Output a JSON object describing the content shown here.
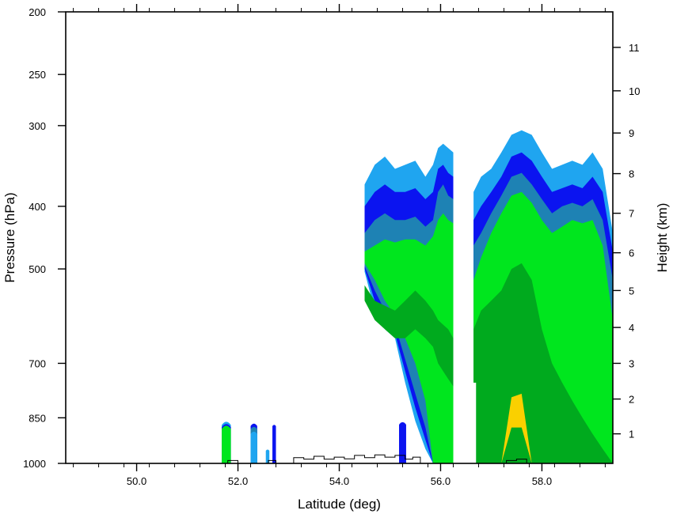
{
  "chart_data": {
    "type": "contour",
    "title": "",
    "xlabel": "Latitude (deg)",
    "ylabel": "Pressure (hPa)",
    "y2label": "Height (km)",
    "x_range": [
      48.6,
      59.4
    ],
    "x_ticks": [
      "50.0",
      "52.0",
      "54.0",
      "56.0",
      "58.0"
    ],
    "x_tick_values": [
      50,
      52,
      54,
      56,
      58
    ],
    "y_range_hpa": [
      1000,
      200
    ],
    "y_scale": "log",
    "y_ticks": [
      "200",
      "250",
      "300",
      "400",
      "500",
      "700",
      "850",
      "1000"
    ],
    "y_tick_values": [
      200,
      250,
      300,
      400,
      500,
      700,
      850,
      1000
    ],
    "y2_ticks": [
      "1",
      "2",
      "3",
      "4",
      "5",
      "6",
      "7",
      "8",
      "9",
      "10",
      "11"
    ],
    "y2_tick_values": [
      1,
      2,
      3,
      4,
      5,
      6,
      7,
      8,
      9,
      10,
      11
    ],
    "y2_ref_hpa": [
      900,
      795,
      700,
      616,
      540,
      472,
      410,
      356,
      308,
      265,
      227
    ],
    "grid": false,
    "legend": "none",
    "contour_levels": [
      {
        "name": "level-1",
        "color": "#1fa5f0"
      },
      {
        "name": "level-2",
        "color": "#0b14f0"
      },
      {
        "name": "level-3",
        "color": "#1e82b4"
      },
      {
        "name": "level-4",
        "color": "#00e61e"
      },
      {
        "name": "level-5",
        "color": "#00aa1e"
      },
      {
        "name": "level-6",
        "color": "#fad000"
      }
    ],
    "cells": [
      {
        "x0": 51.68,
        "x1": 51.86,
        "levels": [
          [
            1,
            1000,
            858
          ],
          [
            2,
            1000,
            865
          ],
          [
            4,
            1000,
            870
          ]
        ]
      },
      {
        "x0": 52.25,
        "x1": 52.38,
        "levels": [
          [
            2,
            1000,
            865
          ],
          [
            3,
            1000,
            875
          ],
          [
            1,
            1000,
            890
          ]
        ]
      },
      {
        "x0": 52.55,
        "x1": 52.62,
        "levels": [
          [
            1,
            1000,
            950
          ]
        ]
      },
      {
        "x0": 52.68,
        "x1": 52.75,
        "levels": [
          [
            2,
            1000,
            870
          ]
        ]
      },
      {
        "x0": 55.18,
        "x1": 55.32,
        "levels": [
          [
            2,
            1000,
            860
          ]
        ]
      }
    ],
    "plumes": [
      {
        "name": "plume-54-56",
        "x": [
          54.5,
          54.7,
          54.9,
          55.1,
          55.3,
          55.5,
          55.7,
          55.85,
          55.95,
          56.05,
          56.15,
          56.25
        ],
        "levels": [
          {
            "level": 1,
            "top": [
              370,
              345,
              335,
              350,
              345,
              340,
              360,
              345,
              325,
              320,
              325,
              330
            ],
            "bottom": [
              505,
              580,
              620,
              640,
              750,
              860,
              950,
              1000,
              1000,
              1000,
              1000,
              1000
            ]
          },
          {
            "level": 2,
            "top": [
              400,
              380,
              370,
              380,
              380,
              375,
              390,
              380,
              350,
              345,
              355,
              360
            ],
            "bottom": [
              500,
              560,
              600,
              630,
              720,
              820,
              920,
              1000,
              1000,
              1000,
              1000,
              1000
            ]
          },
          {
            "level": 3,
            "top": [
              440,
              420,
              410,
              420,
              420,
              415,
              430,
              420,
              380,
              370,
              385,
              390
            ],
            "bottom": [
              495,
              540,
              580,
              610,
              690,
              780,
              880,
              1000,
              1000,
              1000,
              1000,
              1000
            ]
          },
          {
            "level": 4,
            "top": [
              470,
              460,
              450,
              455,
              450,
              450,
              460,
              445,
              420,
              410,
              420,
              425
            ],
            "bottom": [
              490,
              520,
              560,
              590,
              640,
              700,
              800,
              1000,
              1000,
              1000,
              1000,
              1000
            ]
          },
          {
            "level": 5,
            "top": [
              530,
              560,
              570,
              580,
              560,
              540,
              560,
              580,
              600,
              610,
              620,
              640
            ],
            "bottom": [
              560,
              600,
              620,
              640,
              640,
              620,
              640,
              660,
              700,
              720,
              740,
              760
            ]
          }
        ]
      },
      {
        "name": "plume-57-59",
        "x": [
          56.65,
          56.8,
          57.0,
          57.2,
          57.4,
          57.6,
          57.8,
          58.0,
          58.2,
          58.4,
          58.6,
          58.8,
          59.0,
          59.2,
          59.4
        ],
        "levels": [
          {
            "level": 1,
            "top": [
              380,
              360,
              350,
              330,
              310,
              305,
              310,
              330,
              350,
              345,
              340,
              345,
              330,
              350,
              440
            ],
            "bottom": [
              1000,
              1000,
              1000,
              1000,
              1000,
              1000,
              1000,
              1000,
              1000,
              1000,
              1000,
              1000,
              1000,
              1000,
              1000
            ]
          },
          {
            "level": 2,
            "top": [
              420,
              400,
              380,
              360,
              335,
              330,
              340,
              360,
              380,
              375,
              370,
              375,
              360,
              380,
              470
            ],
            "bottom": [
              1000,
              1000,
              1000,
              1000,
              1000,
              1000,
              1000,
              1000,
              1000,
              1000,
              1000,
              1000,
              1000,
              1000,
              1000
            ]
          },
          {
            "level": 3,
            "top": [
              460,
              440,
              410,
              385,
              360,
              355,
              370,
              390,
              410,
              400,
              395,
              400,
              390,
              420,
              520
            ],
            "bottom": [
              1000,
              1000,
              1000,
              1000,
              1000,
              1000,
              1000,
              1000,
              1000,
              1000,
              1000,
              1000,
              1000,
              1000,
              1000
            ]
          },
          {
            "level": 4,
            "top": [
              520,
              480,
              440,
              410,
              385,
              380,
              395,
              420,
              440,
              430,
              420,
              425,
              420,
              460,
              600
            ],
            "bottom": [
              1000,
              1000,
              1000,
              1000,
              1000,
              1000,
              1000,
              1000,
              1000,
              1000,
              1000,
              1000,
              1000,
              1000,
              1000
            ]
          },
          {
            "level": 5,
            "top": [
              620,
              580,
              560,
              540,
              500,
              490,
              520,
              620,
              700,
              750,
              800,
              850,
              900,
              950,
              1000
            ],
            "bottom": [
              1000,
              1000,
              1000,
              1000,
              1000,
              1000,
              1000,
              1000,
              1000,
              1000,
              1000,
              1000,
              1000,
              1000,
              1000
            ]
          },
          {
            "level": 6,
            "top": [
              1000,
              1000,
              1000,
              1000,
              790,
              780,
              1000,
              1000,
              1000,
              1000,
              1000,
              1000,
              1000,
              1000,
              1000
            ],
            "bottom": [
              1000,
              1000,
              1000,
              1000,
              880,
              880,
              1000,
              1000,
              1000,
              1000,
              1000,
              1000,
              1000,
              1000,
              1000
            ]
          }
        ]
      }
    ],
    "terrain_hpa": [
      [
        48.6,
        1000
      ],
      [
        51.8,
        1000
      ],
      [
        51.8,
        990
      ],
      [
        52.0,
        990
      ],
      [
        52.0,
        1000
      ],
      [
        52.6,
        1000
      ],
      [
        52.6,
        990
      ],
      [
        52.75,
        990
      ],
      [
        52.75,
        1000
      ],
      [
        53.1,
        1000
      ],
      [
        53.1,
        980
      ],
      [
        53.3,
        980
      ],
      [
        53.3,
        985
      ],
      [
        53.5,
        985
      ],
      [
        53.5,
        975
      ],
      [
        53.7,
        975
      ],
      [
        53.7,
        985
      ],
      [
        53.9,
        985
      ],
      [
        53.9,
        978
      ],
      [
        54.1,
        978
      ],
      [
        54.1,
        984
      ],
      [
        54.3,
        984
      ],
      [
        54.3,
        972
      ],
      [
        54.5,
        972
      ],
      [
        54.5,
        980
      ],
      [
        54.7,
        980
      ],
      [
        54.7,
        970
      ],
      [
        54.9,
        970
      ],
      [
        54.9,
        978
      ],
      [
        55.1,
        978
      ],
      [
        55.1,
        972
      ],
      [
        55.3,
        972
      ],
      [
        55.3,
        985
      ],
      [
        55.45,
        985
      ],
      [
        55.45,
        978
      ],
      [
        55.6,
        978
      ],
      [
        55.6,
        1000
      ],
      [
        57.3,
        1000
      ],
      [
        57.3,
        990
      ],
      [
        57.5,
        990
      ],
      [
        57.5,
        985
      ],
      [
        57.7,
        985
      ],
      [
        57.7,
        1000
      ],
      [
        59.4,
        1000
      ]
    ]
  }
}
